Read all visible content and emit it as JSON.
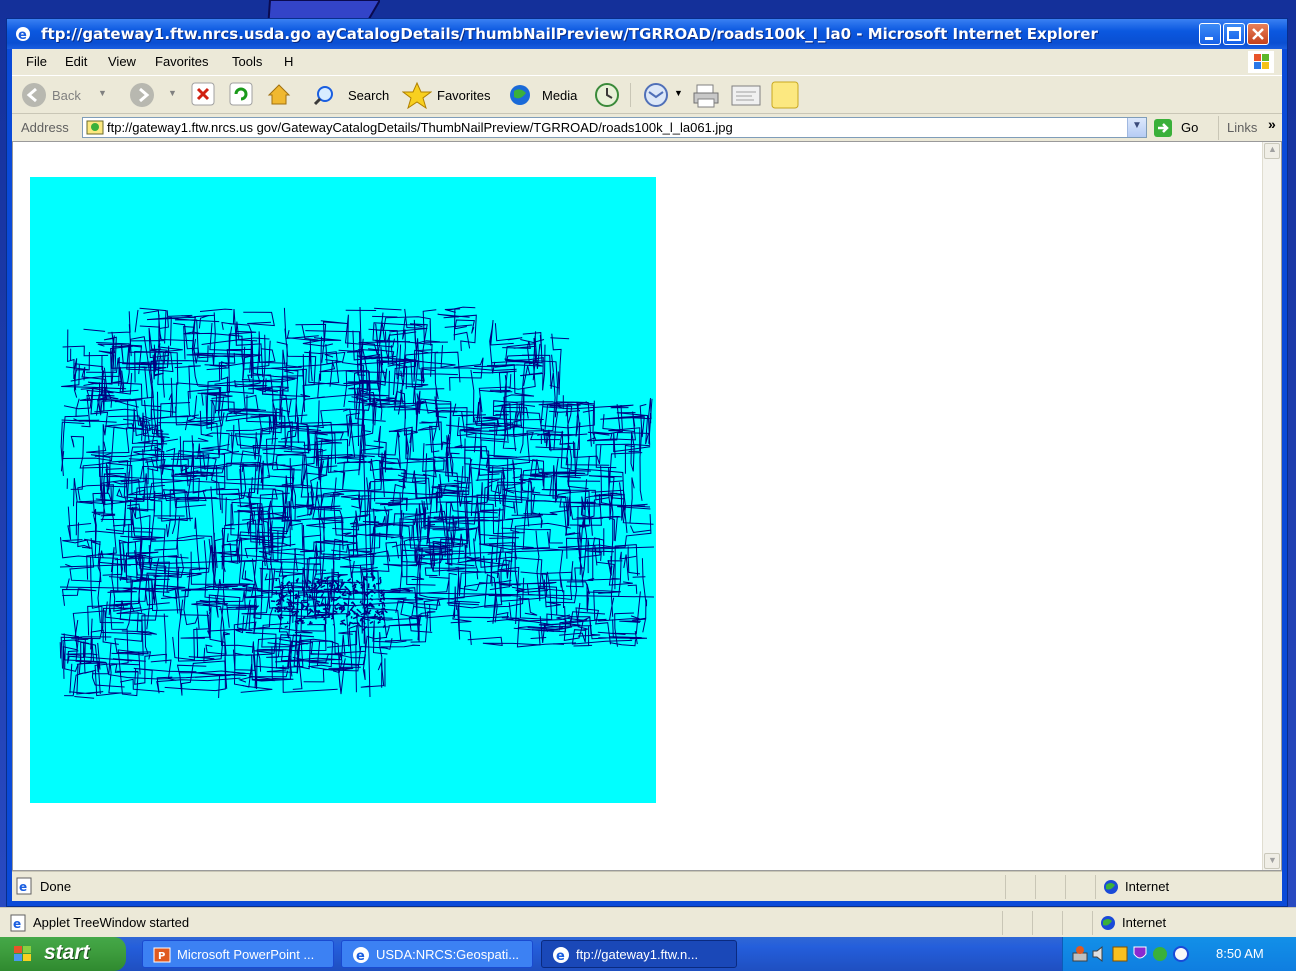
{
  "window": {
    "title": "ftp://gateway1.ftw.nrcs.usda.go       ayCatalogDetails/ThumbNailPreview/TGRROAD/roads100k_l_la0 - Microsoft Internet Explorer"
  },
  "menu": {
    "items": [
      "File",
      "Edit",
      "View",
      "Favorites",
      "Tools",
      "H"
    ]
  },
  "toolbar": {
    "back_label": "Back",
    "search_label": "Search",
    "favorites_label": "Favorites",
    "media_label": "Media"
  },
  "address": {
    "label": "Address",
    "url": "ftp://gateway1.ftw.nrcs.us       gov/GatewayCatalogDetails/ThumbNailPreview/TGRROAD/roads100k_l_la061.jpg",
    "go_label": "Go",
    "links_label": "Links"
  },
  "status": {
    "text": "Done",
    "zone": "Internet"
  },
  "status2": {
    "text": "Applet TreeWindow started",
    "zone": "Internet"
  },
  "taskbar": {
    "start_label": "start",
    "tasks": [
      "Microsoft PowerPoint ...",
      "USDA:NRCS:Geospati...",
      "ftp://gateway1.ftw.n..."
    ],
    "clock": "8:50 AM"
  },
  "colors": {
    "map_background": "#00ffff",
    "roads": "#000080"
  }
}
